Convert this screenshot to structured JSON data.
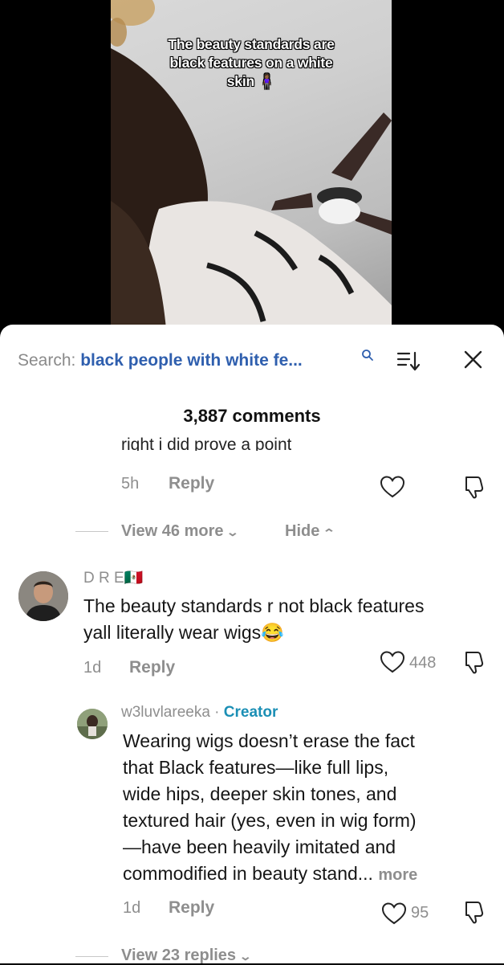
{
  "video": {
    "caption_lines": [
      "The beauty standards are",
      "black features on a white",
      "skin 🧍🏾‍♀️"
    ]
  },
  "header": {
    "search_label": "Search:",
    "search_query": "black people with white fe...",
    "search_icon": "search-icon",
    "sort_icon": "sort-icon",
    "close_icon": "close-icon"
  },
  "comments_count": "3,887 comments",
  "prev_reply": {
    "text": "right i did prove a point",
    "time": "5h",
    "reply_label": "Reply"
  },
  "thread_controls": {
    "view_more": "View 46 more",
    "hide": "Hide"
  },
  "comment": {
    "username": "D R E🇲🇽",
    "text_lines": [
      "The beauty standards r not black features",
      "yall literally wear wigs😂"
    ],
    "time": "1d",
    "reply_label": "Reply",
    "likes": "448"
  },
  "creator_reply": {
    "username": "w3luvlareeka",
    "separator": " · ",
    "badge": "Creator",
    "text_lines": [
      "Wearing wigs doesn’t erase the fact",
      "that Black features—like full lips,",
      "wide hips, deeper skin tones, and",
      "textured hair (yes, even in wig form)",
      "—have been heavily imitated and",
      "commodified in beauty stand..."
    ],
    "more": "more",
    "time": "1d",
    "reply_label": "Reply",
    "likes": "95"
  },
  "view_replies": "View 23 replies",
  "colors": {
    "query_blue": "#2f5fae",
    "creator_blue": "#1b8fb5",
    "muted_gray": "#8e8e8e"
  }
}
